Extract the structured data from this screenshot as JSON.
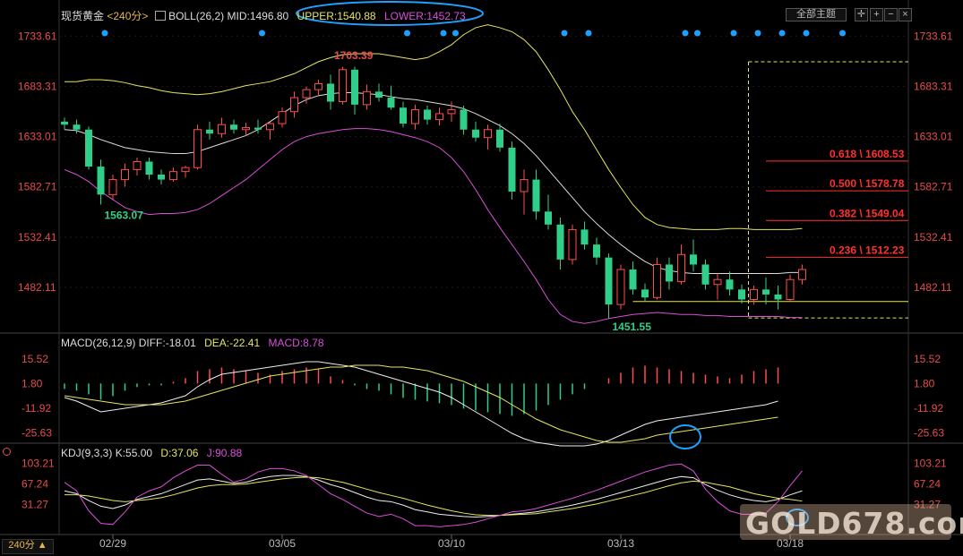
{
  "header": {
    "symbol": "现货黄金",
    "period": "<240分>",
    "indicator": "BOLL(26,2)",
    "mid": "MID:1496.80",
    "upper": "UPPER:1540.88",
    "lower": "LOWER:1452.73",
    "theme_button": "全部主题",
    "period_button": "240分 ▲"
  },
  "macd_header": {
    "label": "MACD(26,12,9)",
    "diff": "DIFF:-18.01",
    "dea": "DEA:-22.41",
    "macd": "MACD:8.78"
  },
  "kdj_header": {
    "label": "KDJ(9,3,3)",
    "k": "K:55.00",
    "d": "D:37.06",
    "j": "J:90.88"
  },
  "watermark": "GOLD678.com",
  "colors": {
    "up": "#ff4d4d",
    "down": "#2fcf8a",
    "mid": "#dddddd",
    "upper": "#e6e65c",
    "lower": "#d94fd9",
    "text_red": "#e84c4c",
    "fib": "#ff3030",
    "gold_line": "#e6e65c",
    "accent": "#1fa0ff"
  },
  "chart_data": {
    "type": "candlestick",
    "price_axis": {
      "ticks": [
        1733.61,
        1683.31,
        1633.01,
        1582.71,
        1532.41,
        1482.11
      ],
      "range": [
        1440,
        1750
      ]
    },
    "x_ticks": [
      {
        "label": "02/29",
        "index": 4
      },
      {
        "label": "03/05",
        "index": 18
      },
      {
        "label": "03/10",
        "index": 32
      },
      {
        "label": "03/13",
        "index": 46
      },
      {
        "label": "03/18",
        "index": 60
      }
    ],
    "candles": [
      [
        1648,
        1652,
        1640,
        1645
      ],
      [
        1645,
        1650,
        1636,
        1640
      ],
      [
        1640,
        1643,
        1600,
        1603
      ],
      [
        1603,
        1610,
        1565,
        1575
      ],
      [
        1575,
        1595,
        1570,
        1590
      ],
      [
        1590,
        1606,
        1583,
        1600
      ],
      [
        1600,
        1612,
        1594,
        1608
      ],
      [
        1608,
        1612,
        1590,
        1595
      ],
      [
        1595,
        1600,
        1585,
        1590
      ],
      [
        1590,
        1602,
        1588,
        1598
      ],
      [
        1598,
        1604,
        1592,
        1602
      ],
      [
        1602,
        1645,
        1600,
        1640
      ],
      [
        1640,
        1648,
        1630,
        1636
      ],
      [
        1636,
        1652,
        1632,
        1645
      ],
      [
        1645,
        1650,
        1636,
        1640
      ],
      [
        1640,
        1647,
        1634,
        1642
      ],
      [
        1642,
        1650,
        1636,
        1640
      ],
      [
        1640,
        1648,
        1630,
        1646
      ],
      [
        1646,
        1662,
        1642,
        1658
      ],
      [
        1658,
        1678,
        1652,
        1672
      ],
      [
        1672,
        1683,
        1666,
        1680
      ],
      [
        1680,
        1690,
        1674,
        1686
      ],
      [
        1686,
        1695,
        1660,
        1668
      ],
      [
        1668,
        1703,
        1665,
        1700
      ],
      [
        1700,
        1703,
        1655,
        1665
      ],
      [
        1665,
        1685,
        1660,
        1678
      ],
      [
        1678,
        1686,
        1668,
        1672
      ],
      [
        1672,
        1684,
        1660,
        1662
      ],
      [
        1662,
        1668,
        1642,
        1646
      ],
      [
        1646,
        1665,
        1640,
        1660
      ],
      [
        1660,
        1664,
        1645,
        1650
      ],
      [
        1650,
        1662,
        1644,
        1656
      ],
      [
        1656,
        1668,
        1648,
        1660
      ],
      [
        1660,
        1664,
        1635,
        1640
      ],
      [
        1640,
        1648,
        1628,
        1632
      ],
      [
        1632,
        1645,
        1620,
        1640
      ],
      [
        1640,
        1646,
        1618,
        1622
      ],
      [
        1622,
        1628,
        1570,
        1578
      ],
      [
        1578,
        1600,
        1555,
        1590
      ],
      [
        1590,
        1600,
        1550,
        1558
      ],
      [
        1558,
        1575,
        1540,
        1545
      ],
      [
        1545,
        1552,
        1500,
        1510
      ],
      [
        1510,
        1545,
        1505,
        1540
      ],
      [
        1540,
        1548,
        1520,
        1525
      ],
      [
        1525,
        1532,
        1505,
        1512
      ],
      [
        1512,
        1516,
        1451,
        1465
      ],
      [
        1465,
        1505,
        1460,
        1500
      ],
      [
        1500,
        1508,
        1475,
        1480
      ],
      [
        1480,
        1486,
        1468,
        1472
      ],
      [
        1472,
        1512,
        1470,
        1505
      ],
      [
        1505,
        1512,
        1480,
        1488
      ],
      [
        1488,
        1525,
        1485,
        1515
      ],
      [
        1515,
        1530,
        1498,
        1505
      ],
      [
        1505,
        1510,
        1480,
        1485
      ],
      [
        1485,
        1496,
        1470,
        1490
      ],
      [
        1490,
        1498,
        1474,
        1480
      ],
      [
        1480,
        1485,
        1466,
        1470
      ],
      [
        1470,
        1484,
        1465,
        1480
      ],
      [
        1480,
        1492,
        1465,
        1475
      ],
      [
        1475,
        1484,
        1460,
        1470
      ],
      [
        1470,
        1495,
        1468,
        1490
      ],
      [
        1490,
        1505,
        1485,
        1500
      ]
    ],
    "boll": {
      "upper": [
        1688,
        1688,
        1690,
        1690,
        1689,
        1687,
        1684,
        1682,
        1679,
        1677,
        1676,
        1675,
        1676,
        1678,
        1681,
        1684,
        1686,
        1688,
        1692,
        1696,
        1702,
        1708,
        1712,
        1715,
        1716,
        1716,
        1716,
        1714,
        1712,
        1710,
        1712,
        1718,
        1725,
        1735,
        1742,
        1745,
        1742,
        1738,
        1730,
        1718,
        1700,
        1680,
        1658,
        1640,
        1620,
        1600,
        1582,
        1565,
        1552,
        1545,
        1542,
        1541,
        1540,
        1540,
        1540,
        1541,
        1541,
        1540,
        1540,
        1540,
        1540,
        1541
      ],
      "mid": [
        1640,
        1639,
        1635,
        1630,
        1626,
        1622,
        1620,
        1618,
        1617,
        1616,
        1616,
        1618,
        1622,
        1626,
        1630,
        1634,
        1640,
        1648,
        1656,
        1664,
        1670,
        1674,
        1676,
        1677,
        1677,
        1676,
        1675,
        1673,
        1671,
        1670,
        1668,
        1666,
        1664,
        1661,
        1656,
        1650,
        1644,
        1636,
        1626,
        1614,
        1600,
        1586,
        1572,
        1558,
        1546,
        1535,
        1525,
        1516,
        1508,
        1502,
        1499,
        1497,
        1496,
        1496,
        1496,
        1496,
        1496,
        1496,
        1496,
        1496,
        1497,
        1497
      ],
      "lower": [
        1600,
        1595,
        1588,
        1578,
        1570,
        1562,
        1558,
        1555,
        1556,
        1556,
        1557,
        1560,
        1566,
        1574,
        1582,
        1590,
        1600,
        1610,
        1620,
        1628,
        1633,
        1636,
        1638,
        1640,
        1641,
        1641,
        1640,
        1638,
        1635,
        1632,
        1628,
        1622,
        1612,
        1598,
        1580,
        1560,
        1542,
        1525,
        1508,
        1490,
        1470,
        1455,
        1448,
        1446,
        1448,
        1451,
        1453,
        1455,
        1456,
        1457,
        1456,
        1455,
        1455,
        1454,
        1454,
        1453,
        1453,
        1453,
        1453,
        1453,
        1452,
        1452
      ]
    },
    "annotations": [
      {
        "text": "1703.39",
        "index": 22,
        "value": 1703.39,
        "color": "red"
      },
      {
        "text": "1563.07",
        "index": 3,
        "value": 1563.07,
        "color": "green"
      },
      {
        "text": "1451.55",
        "index": 45,
        "value": 1451.55,
        "color": "green"
      }
    ],
    "fib_levels": [
      {
        "label": "0.618 \\ 1608.53",
        "value": 1608.53
      },
      {
        "label": "0.500 \\ 1578.78",
        "value": 1578.78
      },
      {
        "label": "0.382 \\ 1549.04",
        "value": 1549.04
      },
      {
        "label": "0.236 \\ 1512.23",
        "value": 1512.23
      }
    ],
    "fib_box": {
      "high": 1703.39,
      "low": 1451.55
    },
    "support_line": 1468,
    "top_dots": [
      0,
      13,
      25,
      28,
      29,
      38,
      40,
      48,
      49,
      52,
      54,
      56,
      58,
      61
    ],
    "macd": {
      "ticks": [
        15.52,
        1.8,
        -11.92,
        -25.63
      ],
      "range": [
        -33,
        22
      ],
      "diff": [
        -6,
        -8,
        -11,
        -14,
        -13,
        -12,
        -11,
        -10,
        -9,
        -7,
        -5,
        0,
        4,
        7,
        8,
        9,
        10,
        11,
        12,
        13,
        14,
        14,
        13,
        12,
        11,
        9,
        7,
        5,
        3,
        1,
        -1,
        -3,
        -6,
        -10,
        -14,
        -18,
        -22,
        -26,
        -29,
        -31,
        -32,
        -33,
        -33,
        -33,
        -32,
        -30,
        -27,
        -24,
        -21,
        -19,
        -18,
        -17,
        -16,
        -15,
        -14,
        -13,
        -12,
        -11,
        -10,
        -8
      ],
      "dea": [
        -5,
        -6,
        -7,
        -8,
        -9,
        -10,
        -10,
        -10,
        -10,
        -9,
        -8,
        -6,
        -4,
        -2,
        0,
        2,
        4,
        6,
        7,
        8,
        9,
        10,
        11,
        11,
        12,
        12,
        12,
        11,
        11,
        10,
        9,
        7,
        5,
        3,
        0,
        -3,
        -6,
        -10,
        -14,
        -18,
        -21,
        -24,
        -26,
        -28,
        -30,
        -31,
        -31,
        -30,
        -29,
        -27,
        -26,
        -25,
        -24,
        -23,
        -22,
        -21,
        -20,
        -19,
        -18,
        -17
      ],
      "hist": [
        -3,
        -4,
        -6,
        -9,
        -7,
        -4,
        -2,
        -1,
        -1,
        1,
        3,
        7,
        8,
        9,
        8,
        7,
        6,
        5,
        7,
        8,
        9,
        8,
        4,
        2,
        -1,
        -3,
        -4,
        -6,
        -8,
        -9,
        -10,
        -11,
        -12,
        -14,
        -15,
        -16,
        -17,
        -18,
        -17,
        -15,
        -12,
        -9,
        -6,
        -3,
        0,
        3,
        6,
        9,
        10,
        9,
        8,
        7,
        6,
        5,
        4,
        3,
        5,
        7,
        8,
        9
      ]
    },
    "kdj": {
      "ticks": [
        103.21,
        67.24,
        31.27
      ],
      "range": [
        -20,
        115
      ],
      "k": [
        55,
        50,
        38,
        28,
        24,
        30,
        40,
        45,
        50,
        58,
        66,
        74,
        76,
        72,
        68,
        70,
        76,
        80,
        82,
        82,
        80,
        74,
        66,
        60,
        52,
        44,
        38,
        36,
        30,
        22,
        18,
        14,
        12,
        10,
        9,
        10,
        12,
        14,
        16,
        18,
        22,
        26,
        30,
        35,
        40,
        46,
        52,
        58,
        64,
        70,
        76,
        80,
        78,
        66,
        56,
        48,
        42,
        38,
        36,
        40,
        48,
        55
      ],
      "d": [
        48,
        48,
        46,
        42,
        38,
        36,
        38,
        40,
        43,
        48,
        54,
        60,
        64,
        66,
        66,
        67,
        70,
        73,
        76,
        78,
        79,
        78,
        74,
        70,
        64,
        58,
        52,
        47,
        42,
        36,
        30,
        25,
        20,
        16,
        13,
        12,
        12,
        13,
        14,
        15,
        18,
        21,
        24,
        28,
        32,
        37,
        42,
        47,
        52,
        58,
        64,
        69,
        72,
        70,
        66,
        62,
        56,
        50,
        46,
        42,
        40,
        37
      ],
      "j": [
        70,
        55,
        20,
        -2,
        -4,
        18,
        44,
        55,
        62,
        78,
        90,
        100,
        100,
        84,
        70,
        76,
        88,
        94,
        94,
        90,
        82,
        66,
        50,
        40,
        28,
        16,
        10,
        14,
        6,
        -6,
        -6,
        -8,
        -6,
        -4,
        0,
        6,
        12,
        18,
        20,
        24,
        30,
        36,
        42,
        49,
        56,
        64,
        72,
        80,
        88,
        94,
        100,
        102,
        90,
        58,
        36,
        20,
        14,
        14,
        16,
        36,
        64,
        90
      ]
    }
  }
}
